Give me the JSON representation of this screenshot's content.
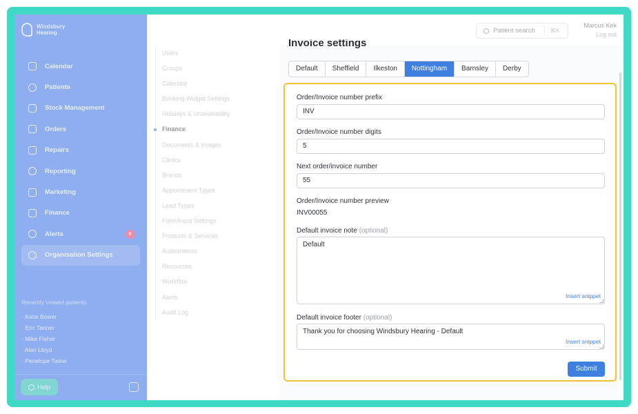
{
  "brand": {
    "name": "Windsbury Hearing"
  },
  "sidebar": {
    "items": [
      {
        "label": "Calendar",
        "icon": "calendar-icon"
      },
      {
        "label": "Patients",
        "icon": "patients-icon"
      },
      {
        "label": "Stock Management",
        "icon": "stock-icon"
      },
      {
        "label": "Orders",
        "icon": "orders-icon"
      },
      {
        "label": "Repairs",
        "icon": "wrench-icon"
      },
      {
        "label": "Reporting",
        "icon": "chart-icon"
      },
      {
        "label": "Marketing",
        "icon": "mail-icon"
      },
      {
        "label": "Finance",
        "icon": "card-icon"
      },
      {
        "label": "Alerts",
        "icon": "bell-icon",
        "badge": "6"
      },
      {
        "label": "Organisation Settings",
        "icon": "gear-icon",
        "active": true
      }
    ],
    "recent_title": "Recently viewed patients",
    "recent": [
      "Katie Bower",
      "Eric Tanner",
      "Mike Fisher",
      "Alan Lloyd",
      "Penelope Twine"
    ],
    "help_label": "Help"
  },
  "topbar": {
    "search_placeholder": "Patient search",
    "search_shortcut": "⌘K",
    "user_name": "Marcus Kirk",
    "logout": "Log out"
  },
  "subnav": {
    "items": [
      "Users",
      "Groups",
      "Calendar",
      "Booking Widget Settings",
      "Holidays & Unavailability",
      "Finance",
      "Documents & Images",
      "Clinics",
      "Brands",
      "Appointment Types",
      "Lead Types",
      "Form/Input Settings",
      "Products & Services",
      "Audiometers",
      "Resources",
      "Workflow",
      "Alerts",
      "Audit Log"
    ],
    "active": "Finance"
  },
  "main": {
    "title": "Invoice settings",
    "tabs": [
      "Default",
      "Sheffield",
      "Ilkeston",
      "Nottingham",
      "Barnsley",
      "Derby"
    ],
    "active_tab": "Nottingham",
    "form": {
      "prefix_label": "Order/Invoice number prefix",
      "prefix_value": "INV",
      "digits_label": "Order/Invoice number digits",
      "digits_value": "5",
      "next_label": "Next order/invoice number",
      "next_value": "55",
      "preview_label": "Order/Invoice number preview",
      "preview_value": "INV00055",
      "note_label": "Default invoice note",
      "note_optional": "(optional)",
      "note_value": "Default",
      "footer_label": "Default invoice footer",
      "footer_optional": "(optional)",
      "footer_value": "Thank you for choosing Windsbury Hearing - Default",
      "insert_snippet": "Insert snippet",
      "submit": "Submit"
    }
  },
  "colors": {
    "accent": "#3f7fe0",
    "sidebar": "#8eaef0",
    "frame": "#3fd9c6",
    "highlight": "#f2c230"
  }
}
